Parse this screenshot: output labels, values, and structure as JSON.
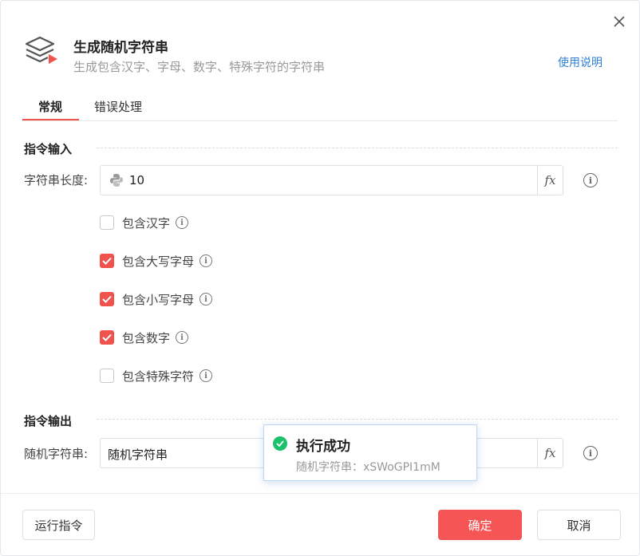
{
  "dialog": {
    "title": "生成随机字符串",
    "subtitle": "生成包含汉字、字母、数字、特殊字符的字符串",
    "help_link": "使用说明",
    "icons": {
      "header": "layers-play-icon",
      "close": "close-icon"
    }
  },
  "tabs": [
    {
      "label": "常规",
      "active": true
    },
    {
      "label": "错误处理",
      "active": false
    }
  ],
  "input_section": {
    "title": "指令输入",
    "length_label": "字符串长度:",
    "length_value": "10",
    "options": [
      {
        "label": "包含汉字",
        "checked": false
      },
      {
        "label": "包含大写字母",
        "checked": true
      },
      {
        "label": "包含小写字母",
        "checked": true
      },
      {
        "label": "包含数字",
        "checked": true
      },
      {
        "label": "包含特殊字符",
        "checked": false
      }
    ]
  },
  "output_section": {
    "title": "指令输出",
    "output_label": "随机字符串:",
    "output_value": "随机字符串"
  },
  "fx_label": "fx",
  "footer": {
    "run_label": "运行指令",
    "confirm_label": "确定",
    "cancel_label": "取消"
  },
  "toast": {
    "title": "执行成功",
    "message": "随机字符串：xSWoGPI1mM"
  },
  "colors": {
    "accent": "#f0534c",
    "primary_button": "#f65556",
    "link": "#2f7fd3",
    "success": "#1ec16b"
  }
}
